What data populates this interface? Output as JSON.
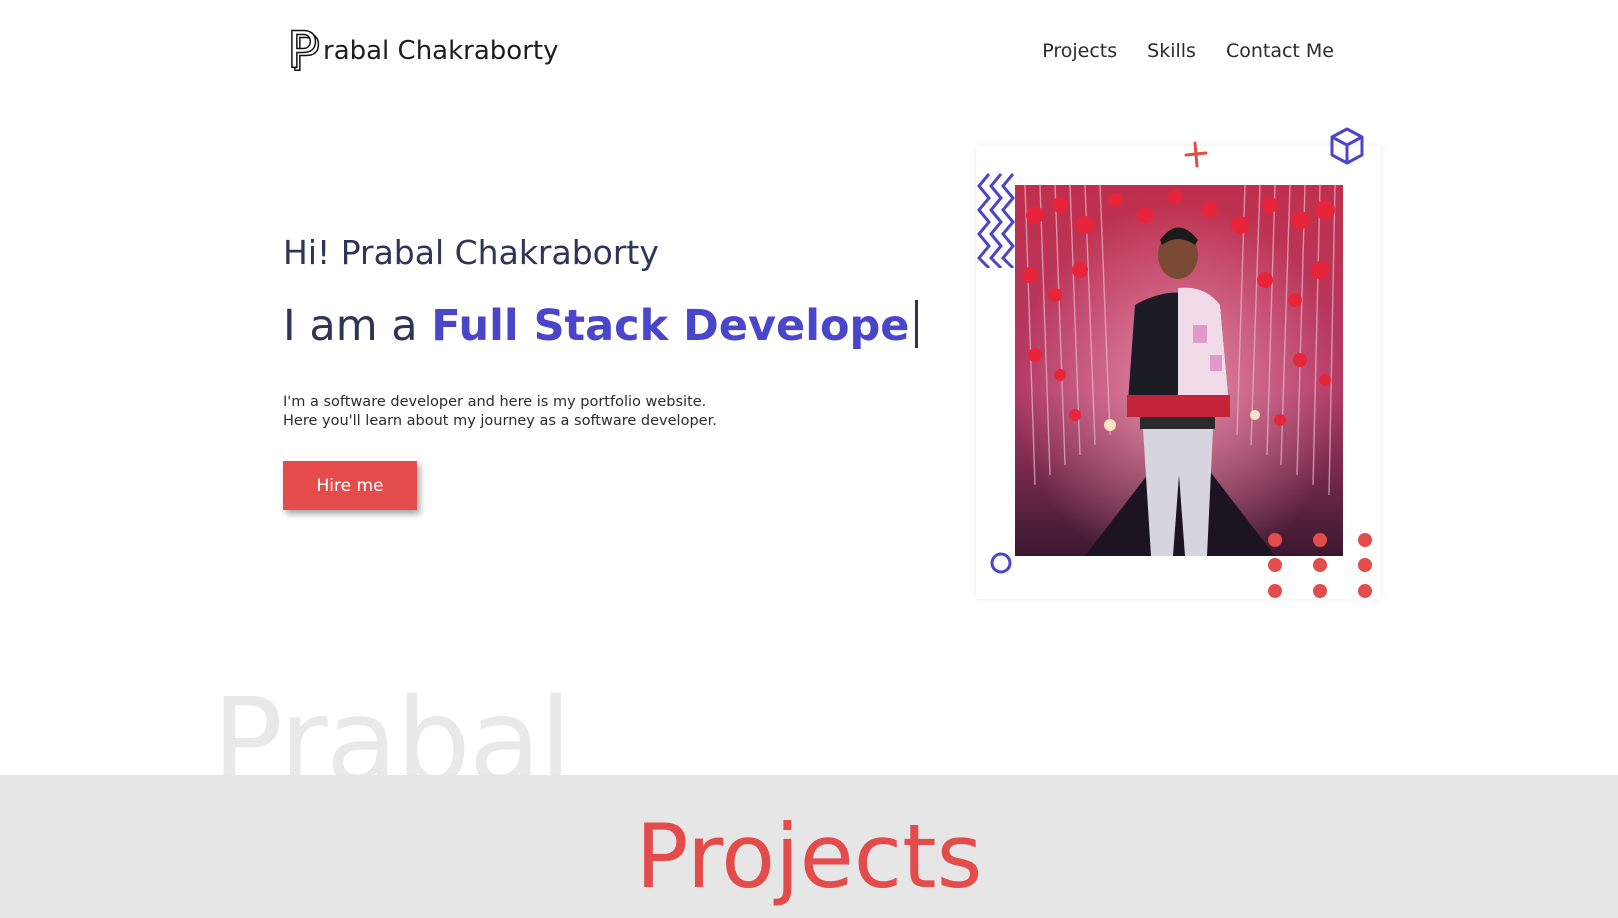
{
  "header": {
    "logo_letter": "P",
    "logo_text": "rabal Chakraborty",
    "nav": [
      {
        "label": "Projects"
      },
      {
        "label": "Skills"
      },
      {
        "label": "Contact Me"
      }
    ]
  },
  "hero": {
    "greeting": "Hi! Prabal Chakraborty",
    "iam_prefix": "I am a ",
    "role": "Full Stack Develope",
    "description": [
      "I'm a software developer and here is my portfolio website.",
      "Here you'll learn about my journey as a software developer."
    ],
    "cta_label": "Hire me"
  },
  "colors": {
    "accent_red": "#e44b4b",
    "accent_blue": "#4b45c9",
    "text_dark": "#2f3556",
    "band_gray": "#e6e6e6"
  },
  "watermark": "Prabal",
  "projects": {
    "title": "Projects"
  }
}
